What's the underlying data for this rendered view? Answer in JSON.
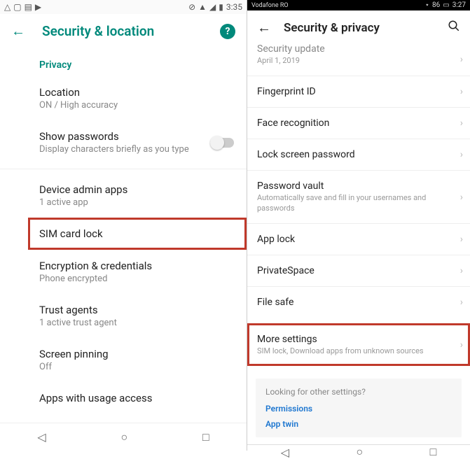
{
  "left": {
    "statusbar": {
      "time": "3:35"
    },
    "appbar": {
      "title": "Security & location"
    },
    "section": "Privacy",
    "items": {
      "location": {
        "title": "Location",
        "sub": "ON / High accuracy"
      },
      "show_passwords": {
        "title": "Show passwords",
        "sub": "Display characters briefly as you type"
      },
      "device_admin": {
        "title": "Device admin apps",
        "sub": "1 active app"
      },
      "sim_lock": {
        "title": "SIM card lock"
      },
      "encryption": {
        "title": "Encryption & credentials",
        "sub": "Phone encrypted"
      },
      "trust_agents": {
        "title": "Trust agents",
        "sub": "1 active trust agent"
      },
      "screen_pinning": {
        "title": "Screen pinning",
        "sub": "Off"
      },
      "apps_usage": {
        "title": "Apps with usage access"
      }
    }
  },
  "right": {
    "statusbar": {
      "carrier": "Vodafone RO",
      "battery": "86",
      "time": "3:27"
    },
    "appbar": {
      "title": "Security & privacy"
    },
    "items": {
      "security_update": {
        "title": "Security update",
        "sub": "April 1, 2019"
      },
      "fingerprint": {
        "title": "Fingerprint ID"
      },
      "face": {
        "title": "Face recognition"
      },
      "lockscreen": {
        "title": "Lock screen password"
      },
      "password_vault": {
        "title": "Password vault",
        "sub": "Automatically save and fill in your usernames and passwords"
      },
      "app_lock": {
        "title": "App lock"
      },
      "private_space": {
        "title": "PrivateSpace"
      },
      "file_safe": {
        "title": "File safe"
      },
      "more": {
        "title": "More settings",
        "sub": "SIM lock, Download apps from unknown sources"
      }
    },
    "footer": {
      "question": "Looking for other settings?",
      "links": {
        "permissions": "Permissions",
        "app_twin": "App twin"
      }
    }
  }
}
